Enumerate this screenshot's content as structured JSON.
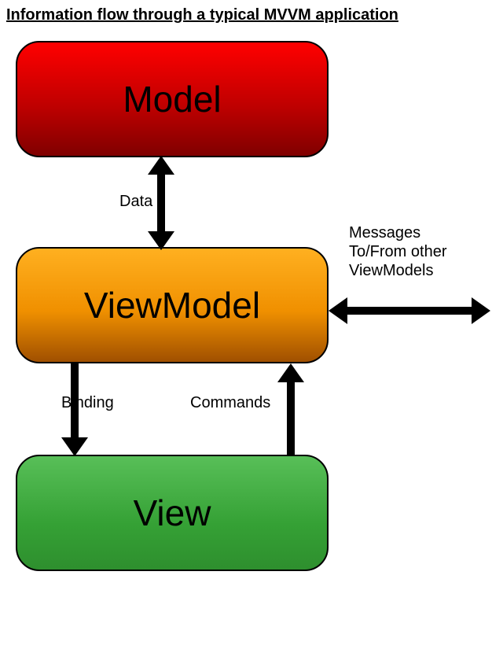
{
  "title": "Information flow through a typical MVVM application",
  "boxes": {
    "model": "Model",
    "viewmodel": "ViewModel",
    "view": "View"
  },
  "labels": {
    "data": "Data",
    "binding": "Binding",
    "commands": "Commands",
    "messages_line1": "Messages",
    "messages_line2": "To/From other",
    "messages_line3": "ViewModels"
  },
  "arrows": {
    "model_viewmodel": {
      "from": "Model",
      "to": "ViewModel",
      "bidirectional": true,
      "label": "Data"
    },
    "viewmodel_external": {
      "from": "ViewModel",
      "to": "Other ViewModels",
      "bidirectional": true,
      "label": "Messages To/From other ViewModels"
    },
    "viewmodel_view_binding": {
      "from": "ViewModel",
      "to": "View",
      "bidirectional": false,
      "label": "Binding"
    },
    "view_viewmodel_commands": {
      "from": "View",
      "to": "ViewModel",
      "bidirectional": false,
      "label": "Commands"
    }
  },
  "colors": {
    "model": "#d00000",
    "viewmodel": "#f09000",
    "view": "#35a135",
    "arrow": "#000000"
  }
}
